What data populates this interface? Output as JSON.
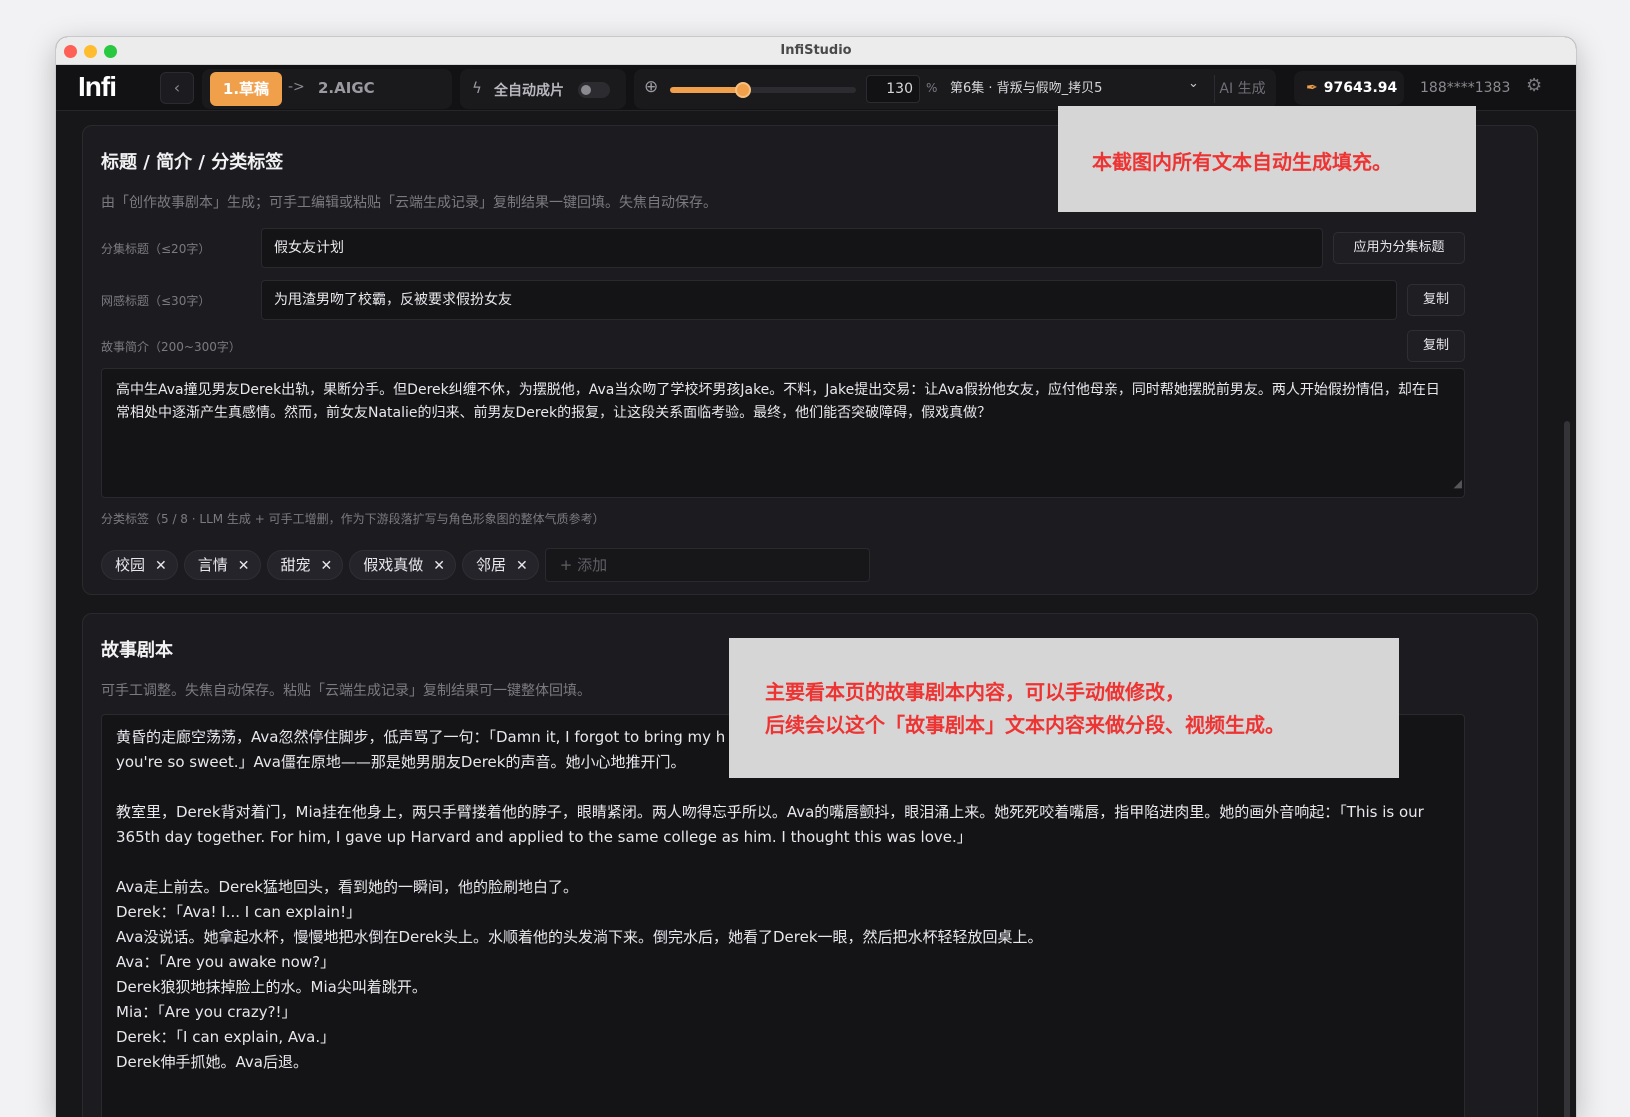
{
  "window": {
    "title": "InfiStudio"
  },
  "toolbar": {
    "logo": "Infi",
    "back_icon": "chevron-left-icon",
    "step_active": "1.草稿",
    "step_arrow": "->",
    "step_next": "2.AIGC",
    "auto_label": "全自动成片",
    "auto_enabled": false,
    "zoom_value": "130",
    "zoom_unit": "%",
    "zoom_slider_fraction": 0.39,
    "episode": "第6集 · 背叛与假吻_拷贝5",
    "ai_button": "AI 生成",
    "credits": "97643.94",
    "phone": "188****1383",
    "accent_color": "#f0a04b"
  },
  "meta_card": {
    "title": "标题 / 简介 / 分类标签",
    "description": "由「创作故事剧本」生成；可手工编辑或粘贴「云端生成记录」复制结果一键回填。失焦自动保存。",
    "episode_title_label": "分集标题（≤20字）",
    "episode_title_value": "假女友计划",
    "apply_button": "应用为分集标题",
    "web_title_label": "网感标题（≤30字）",
    "web_title_value": "为甩渣男吻了校霸，反被要求假扮女友",
    "copy_button": "复制",
    "synopsis_label": "故事简介（200~300字）",
    "synopsis_copy_button": "复制",
    "synopsis_value": "高中生Ava撞见男友Derek出轨，果断分手。但Derek纠缠不休，为摆脱他，Ava当众吻了学校坏男孩Jake。不料，Jake提出交易：让Ava假扮他女友，应付他母亲，同时帮她摆脱前男友。两人开始假扮情侣，却在日常相处中逐渐产生真感情。然而，前女友Natalie的归来、前男友Derek的报复，让这段关系面临考验。最终，他们能否突破障碍，假戏真做？",
    "tags_label": "分类标签（5 / 8 · LLM 生成 + 可手工增删，作为下游段落扩写与角色形象图的整体气质参考）",
    "tags": [
      "校园",
      "言情",
      "甜宠",
      "假戏真做",
      "邻居"
    ],
    "tag_remove": "✕",
    "tag_add_placeholder": "+ 添加"
  },
  "script_card": {
    "title": "故事剧本",
    "description": "可手工调整。失焦自动保存。粘贴「云端生成记录」复制结果可一键整体回填。",
    "paragraphs": [
      "黄昏的走廊空荡荡，Ava忽然停住脚步，低声骂了一句：「Damn it, I forgot to bring my h",
      "you're so sweet.」Ava僵在原地——那是她男朋友Derek的声音。她小心地推开门。",
      "",
      "教室里，Derek背对着门，Mia挂在他身上，两只手臂搂着他的脖子，眼睛紧闭。两人吻得忘乎所以。Ava的嘴唇颤抖，眼泪涌上来。她死死咬着嘴唇，指甲陷进肉里。她的画外音响起：「This is our 365th day together. For him, I gave up Harvard and applied to the same college as him. I thought this was love.」",
      "",
      "Ava走上前去。Derek猛地回头，看到她的一瞬间，他的脸刷地白了。",
      "Derek：「Ava! I... I can explain!」",
      "Ava没说话。她拿起水杯，慢慢地把水倒在Derek头上。水顺着他的头发淌下来。倒完水后，她看了Derek一眼，然后把水杯轻轻放回桌上。",
      "Ava：「Are you awake now?」",
      "Derek狼狈地抹掉脸上的水。Mia尖叫着跳开。",
      "Mia：「Are you crazy?!」",
      "Derek：「I can explain, Ava.」",
      "Derek伸手抓她。Ava后退。"
    ]
  },
  "annotations": {
    "callout1": "本截图内所有文本自动生成填充。",
    "callout2_line1": "主要看本页的故事剧本内容，可以手动做修改，",
    "callout2_line2": "后续会以这个「故事剧本」文本内容来做分段、视频生成。"
  }
}
